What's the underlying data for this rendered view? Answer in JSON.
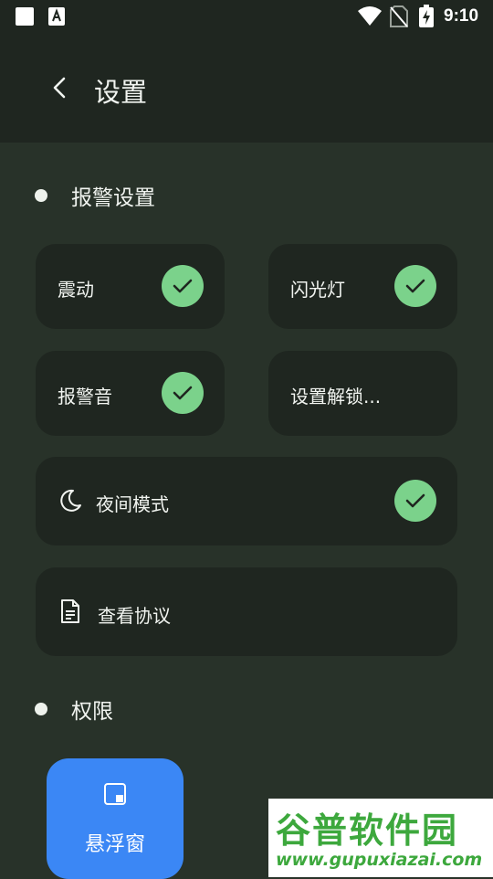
{
  "status_bar": {
    "time": "9:10",
    "icons": [
      "notification-square-icon",
      "app-a-icon",
      "wifi-icon",
      "no-sim-icon",
      "battery-charging-icon"
    ]
  },
  "header": {
    "title": "设置",
    "back_icon": "chevron-left-icon"
  },
  "sections": {
    "alarm": {
      "label": "报警设置"
    },
    "permissions": {
      "label": "权限"
    }
  },
  "alarm_settings": {
    "vibrate": {
      "label": "震动",
      "checked": true
    },
    "flashlight": {
      "label": "闪光灯",
      "checked": true
    },
    "alarm_sound": {
      "label": "报警音",
      "checked": true
    },
    "unlock_settings": {
      "label": "设置解锁..."
    },
    "night_mode": {
      "label": "夜间模式",
      "checked": true,
      "icon": "moon-icon"
    },
    "agreement": {
      "label": "查看协议",
      "icon": "document-icon"
    }
  },
  "permissions": {
    "floating_window": {
      "label": "悬浮窗",
      "icon": "floating-window-icon"
    }
  },
  "watermark": {
    "title": "谷普软件园",
    "url": "www.gupuxiazai.com"
  },
  "colors": {
    "background": "#283229",
    "card": "#1f2620",
    "check": "#7bd28b",
    "accent_blue": "#3b87f5",
    "text": "#f1f4f0"
  }
}
